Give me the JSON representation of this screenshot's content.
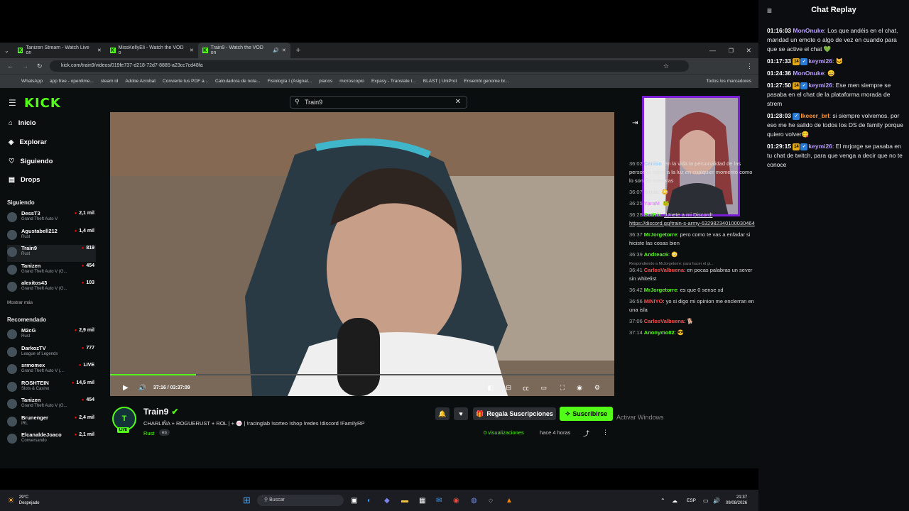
{
  "browser": {
    "tabs": [
      {
        "label": "Tanizen Stream - Watch Live on"
      },
      {
        "label": "MissKellyEli - Watch the VOD o"
      },
      {
        "label": "Train9 - Watch the VOD on"
      }
    ],
    "url": "kick.com/train9/videos/019fe737-d218-72d7-8885-a23cc7cd48fa",
    "bookmarks": [
      "WhatsApp",
      "app free - opentime...",
      "steam id",
      "Adobe Acrobat",
      "Convierte tus PDF a...",
      "Calculadora de nota...",
      "Fisiología I (Asignat...",
      "planos",
      "microscopio",
      "Expasy - Translate t...",
      "BLAST | UniProt",
      "Ensembl genome br..."
    ],
    "all_bookmarks": "Todos los marcadores"
  },
  "kick": {
    "logo": "KICK",
    "search_value": "Train9",
    "nav": [
      {
        "label": "Inicio",
        "icon": "home-icon"
      },
      {
        "label": "Explorar",
        "icon": "compass-icon"
      },
      {
        "label": "Siguiendo",
        "icon": "heart-icon"
      },
      {
        "label": "Drops",
        "icon": "drops-icon"
      }
    ],
    "following_title": "Siguiendo",
    "following": [
      {
        "name": "DessT3",
        "game": "Grand Theft Auto V",
        "viewers": "2,1 mil"
      },
      {
        "name": "Agustabell212",
        "game": "Rust",
        "viewers": "1,4 mil"
      },
      {
        "name": "Train9",
        "game": "Rust",
        "viewers": "819"
      },
      {
        "name": "Tanizen",
        "game": "Grand Theft Auto V (G...",
        "viewers": "454"
      },
      {
        "name": "alexitos43",
        "game": "Grand Theft Auto V (G...",
        "viewers": "103"
      }
    ],
    "show_more": "Mostrar más",
    "recommended_title": "Recomendado",
    "recommended": [
      {
        "name": "M2cG",
        "game": "Rust",
        "viewers": "2,9 mil"
      },
      {
        "name": "DarkozTV",
        "game": "League of Legends",
        "viewers": "777"
      },
      {
        "name": "srmomex",
        "game": "Grand Theft Auto V (...",
        "viewers": "LIVE"
      },
      {
        "name": "ROSHTEIN",
        "game": "Slots & Casino",
        "viewers": "14,5 mil"
      },
      {
        "name": "Tanizen",
        "game": "Grand Theft Auto V (G...",
        "viewers": "454"
      },
      {
        "name": "Brunenger",
        "game": "IRL",
        "viewers": "2,4 mil"
      },
      {
        "name": "ElcanaldeJoaco",
        "game": "Conversando",
        "viewers": "2,1 mil"
      }
    ],
    "video": {
      "time": "37:16 / 03:37:09",
      "progress": 0.17
    },
    "channel": {
      "name": "Train9",
      "live_badge": "LIVE",
      "title": "CHARLIÑA + ROGUERUST + ROL | + 🍥 | !racinglab !sorteo !shop !redes !discord !FamilyRP",
      "category": "Rust",
      "lang": "es",
      "views": "0 visualizaciones",
      "ago": "hace 4 horas",
      "gift_button": "Regala Suscripciones",
      "subscribe_button": "Suscribirse"
    },
    "inner_chat": [
      {
        "time": "36:02",
        "user": "Ceniso",
        "color": "#9cd1ff",
        "text": "en la vida la personalidad de las personas salen a la luz en cualquier momento como lo son las mentiras"
      },
      {
        "time": "36:07",
        "user": "iiruuu",
        "color": "#e7e7e7",
        "text": ""
      },
      {
        "time": "36:25",
        "user": "YaraM",
        "color": "#e38fff",
        "text": ""
      },
      {
        "time": "36:28",
        "user": "BotRix",
        "color": "#53fc18",
        "text": "¡Unete a mi Discord! https://discord.gg/train-s-army-632982340100030464"
      },
      {
        "time": "36:37",
        "user": "MrJorgetorre",
        "color": "#53fc18",
        "text": "pero como te vas a enfadar si hiciste las cosas bien"
      },
      {
        "time": "36:39",
        "user": "Andreac6",
        "color": "#53fc18",
        "text": ""
      },
      {
        "time": "36:41",
        "user": "CarlosValbuena",
        "color": "#ff4d4d",
        "text": "en pocas palabras un sever sin whitelist"
      },
      {
        "time": "36:42",
        "user": "MrJorgetorre",
        "color": "#53fc18",
        "text": "es que 0 sense xd"
      },
      {
        "time": "36:56",
        "user": "MINIYO",
        "color": "#ff4d4d",
        "text": "yo si digo mi opinion me enclerran en una isla"
      },
      {
        "time": "37:06",
        "user": "CarlosValbuena",
        "color": "#ff4d4d",
        "text": ""
      },
      {
        "time": "37:14",
        "user": "Anonymo02",
        "color": "#53fc18",
        "text": ""
      }
    ],
    "replying": "Respondiendo a MrJorgetorre: para hacer el gi...",
    "activate_windows": "Activar Windows"
  },
  "taskbar": {
    "weather_temp": "29°C",
    "weather_desc": "Despejado",
    "search_placeholder": "Buscar",
    "lang": "ESP",
    "time": "21:37",
    "date": "09/08/2026"
  },
  "replay": {
    "title": "Chat Replay",
    "messages": [
      {
        "time": "01:16:03",
        "user": "MonOnuke",
        "color": "#b79cff",
        "text": "Los que andéis en el chat, mandad un emote o algo de vez en cuando para que se active el chat 💚"
      },
      {
        "time": "01:17:33",
        "user": "keymi26",
        "color": "#b79cff",
        "text": ""
      },
      {
        "time": "01:24:36",
        "user": "MonOnuke",
        "color": "#b79cff",
        "text": ""
      },
      {
        "time": "01:27:50",
        "user": "keymi26",
        "color": "#b79cff",
        "text": "Ese men siempre se pasaba en el chat de la plataforma morada de strem"
      },
      {
        "time": "01:28:03",
        "user": "Ikeeer_brl",
        "color": "#ff9a3c",
        "text": "si siempre volvemos. por eso me he salido de todos los DS de family porque quiero volver😋"
      },
      {
        "time": "01:29:15",
        "user": "keymi26",
        "color": "#b79cff",
        "text": "El mrjorge se pasaba en tu chat de twitch, para que venga a decir que no te conoce"
      }
    ]
  }
}
